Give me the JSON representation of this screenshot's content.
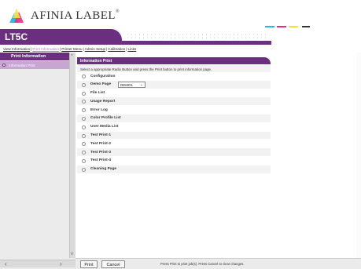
{
  "brand": {
    "name": "AFINIA LABEL",
    "trademark": "®",
    "colors": {
      "cyan": "#2fb5e8",
      "magenta": "#e0307d",
      "yellow": "#f0e040",
      "purple": "#6b2f80"
    }
  },
  "model": {
    "title": "LT5C"
  },
  "nav": {
    "items": [
      {
        "label": "View Information",
        "active": false
      },
      {
        "label": "Print Information",
        "active": true
      },
      {
        "label": "Printer Menu",
        "active": false
      },
      {
        "label": "Admin Setup",
        "active": false
      },
      {
        "label": "Calibration",
        "active": false
      },
      {
        "label": "Links",
        "active": false
      }
    ],
    "separator": "|"
  },
  "sidebar": {
    "heading": "Print Information",
    "items": [
      {
        "label": "Information Print",
        "selected": true
      }
    ]
  },
  "panel": {
    "heading": "Information Print",
    "instruction": "Select a appropriate Radio Button and press the Print button to print information page.",
    "options": [
      {
        "label": "Configuration"
      },
      {
        "label": "Demo Page",
        "select_value": "DEMO1"
      },
      {
        "label": "File List"
      },
      {
        "label": "Usage Report"
      },
      {
        "label": "Error Log"
      },
      {
        "label": "Color Profile List"
      },
      {
        "label": "User Media List"
      },
      {
        "label": "Test Print-1"
      },
      {
        "label": "Test Print-2"
      },
      {
        "label": "Test Print-3"
      },
      {
        "label": "Test Print-4"
      },
      {
        "label": "Cleaning Page"
      }
    ]
  },
  "footer": {
    "print_label": "Print",
    "cancel_label": "Cancel",
    "note": "Press Print to print job(s). Press Cancel to clear changes."
  },
  "icons": {
    "scroll_up": "up-arrow-icon",
    "scroll_down": "down-arrow-icon",
    "scroll_left": "left-arrow-icon",
    "scroll_right": "right-arrow-icon",
    "select_chevron": "chevron-down-icon"
  }
}
